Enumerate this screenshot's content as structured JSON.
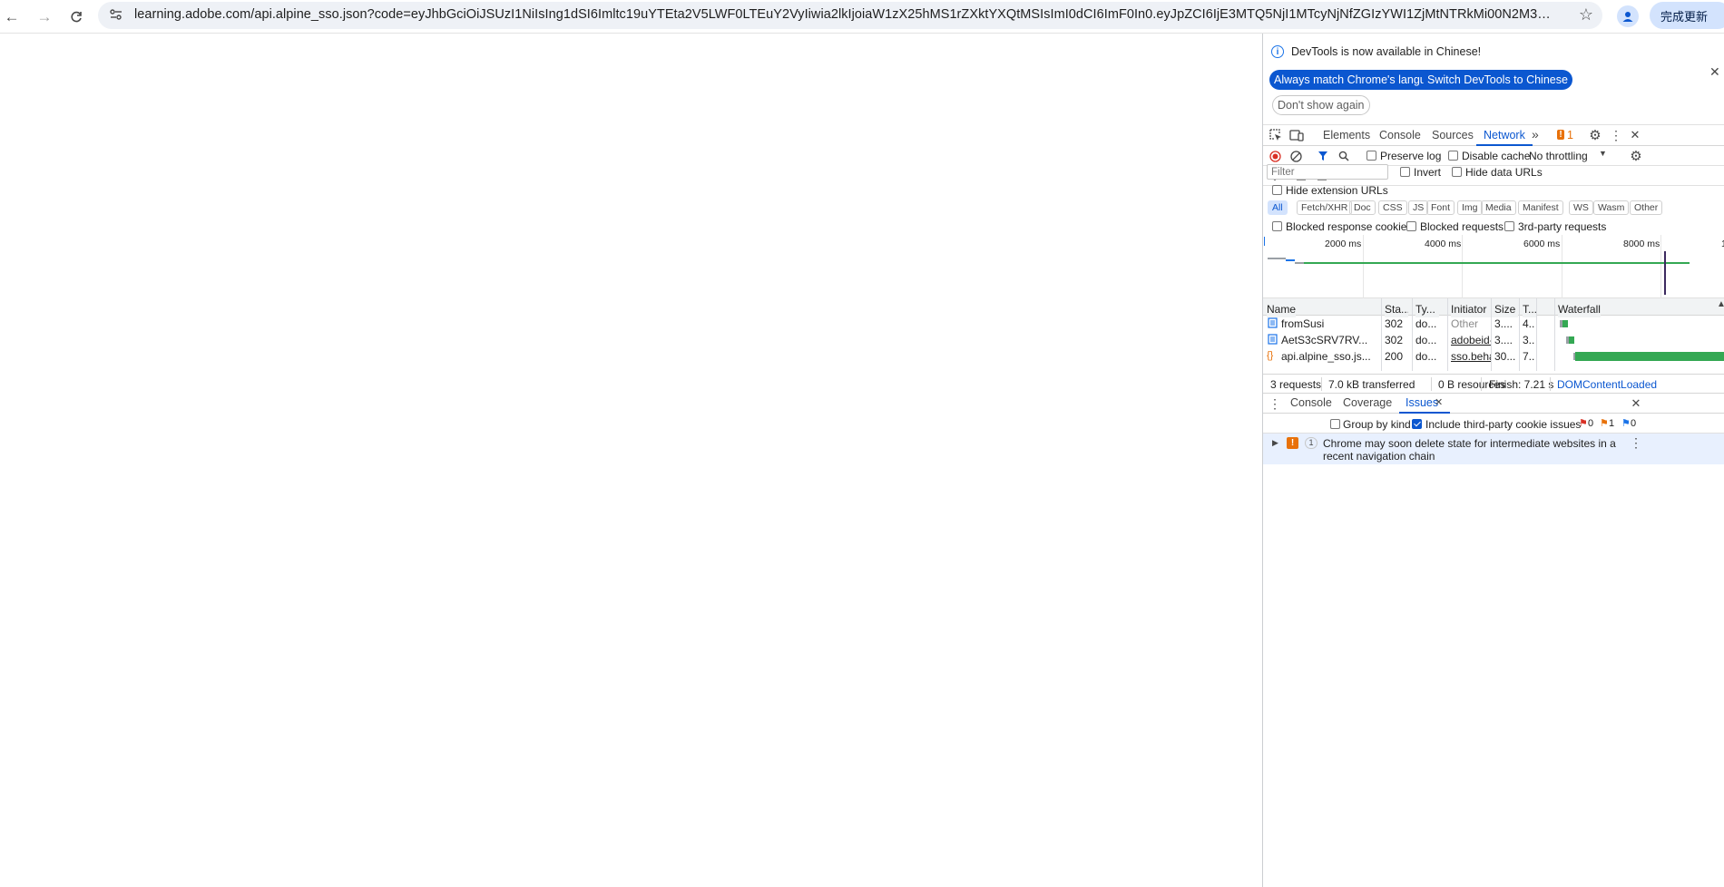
{
  "browser": {
    "url": "learning.adobe.com/api.alpine_sso.json?code=eyJhbGciOiJSUzI1NiIsIng1dSI6Imltc19uYTEta2V5LWF0LTEuY2VyIiwia2lkIjoiaW1zX25hMS1rZXktYXQtMSIsImI0dCI6ImF0In0.eyJpZCI6IjE3MTQ5NjI1MTcyNjNfZGIzYWI1ZjMtNTRkMi00N2M3LT...",
    "update_button": "完成更新"
  },
  "devtools": {
    "info_text": "DevTools is now available in Chinese!",
    "match_language": "Always match Chrome's language",
    "switch_chinese": "Switch DevTools to Chinese",
    "dont_show": "Don't show again",
    "tabs": [
      "Elements",
      "Console",
      "Sources",
      "Network"
    ],
    "issues_count": "1",
    "toolbar": {
      "preserve_log": "Preserve log",
      "disable_cache": "Disable cache",
      "throttling": "No throttling"
    },
    "filter": {
      "placeholder": "Filter",
      "invert": "Invert",
      "hide_data_urls": "Hide data URLs",
      "hide_extension_urls": "Hide extension URLs",
      "chips": [
        "All",
        "Fetch/XHR",
        "Doc",
        "CSS",
        "JS",
        "Font",
        "Img",
        "Media",
        "Manifest",
        "WS",
        "Wasm",
        "Other"
      ],
      "blocked_response_cookies": "Blocked response cookies",
      "blocked_requests": "Blocked requests",
      "third_party": "3rd-party requests"
    },
    "overview_ticks": [
      "2000 ms",
      "4000 ms",
      "6000 ms",
      "8000 ms",
      "1"
    ],
    "columns": [
      "Name",
      "Sta...",
      "Ty...",
      "Initiator",
      "Size",
      "T...",
      "Waterfall"
    ],
    "requests": [
      {
        "name": "fromSusi",
        "status": "302",
        "type": "do...",
        "initiator": "Other",
        "size": "3....",
        "time": "4..."
      },
      {
        "name": "AetS3cSRV7RV...",
        "status": "302",
        "type": "do...",
        "initiator": "adobeid-",
        "size": "3....",
        "time": "3..."
      },
      {
        "name": "api.alpine_sso.js...",
        "status": "200",
        "type": "do...",
        "initiator": "sso.behar",
        "size": "30...",
        "time": "7..."
      }
    ],
    "summary": {
      "requests": "3 requests",
      "transferred": "7.0 kB transferred",
      "resources": "0 B resources",
      "finish": "Finish: 7.21 s",
      "dcl": "DOMContentLoaded"
    },
    "drawer_tabs": [
      "Console",
      "Coverage",
      "Issues"
    ],
    "issues": {
      "group_by_kind": "Group by kind",
      "include_third_party": "Include third-party cookie issues",
      "counts": {
        "errors": "0",
        "warnings": "1",
        "info": "0"
      },
      "item_count": "1",
      "item_text": "Chrome may soon delete state for intermediate websites in a recent navigation chain"
    }
  }
}
